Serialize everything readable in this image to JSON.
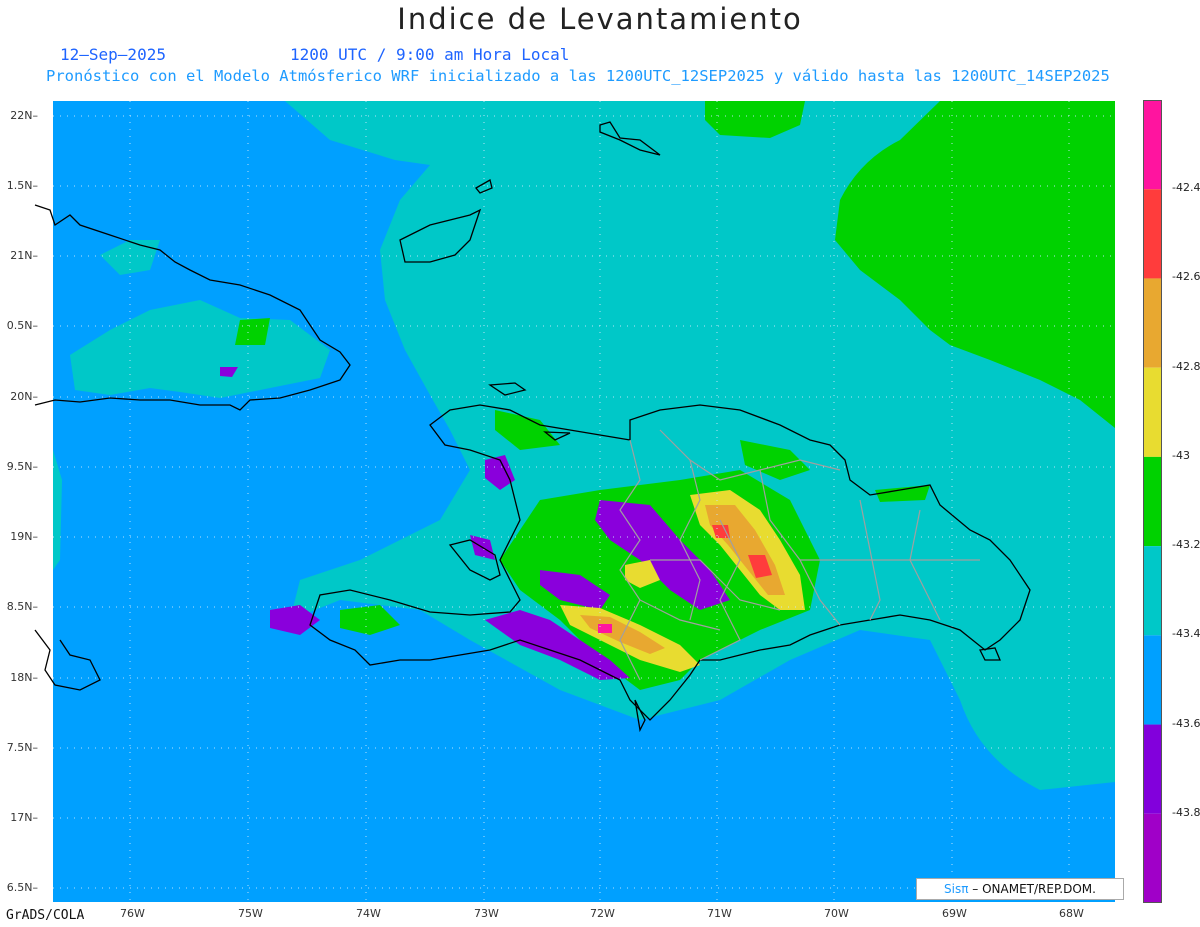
{
  "title": "Indice de Levantamiento",
  "date": "12–Sep–2025",
  "time_label": "1200 UTC / 9:00 am Hora Local",
  "model_line": "Pronóstico con el Modelo Atmósferico WRF inicializado a las 1200UTC_12SEP2025 y válido hasta las  1200UTC_14SEP2025",
  "lat_labels": [
    "22N",
    "1.5N",
    "21N",
    "0.5N",
    "20N",
    "9.5N",
    "19N",
    "8.5N",
    "18N",
    "7.5N",
    "17N",
    "6.5N"
  ],
  "lon_labels": [
    "76W",
    "75W",
    "74W",
    "73W",
    "72W",
    "71W",
    "70W",
    "69W",
    "68W"
  ],
  "colorbar": {
    "labels": [
      "-42.4",
      "-42.6",
      "-42.8",
      "-43",
      "-43.2",
      "-43.4",
      "-43.6",
      "-43.8"
    ],
    "colors": [
      "#ff149f",
      "#ff3c3c",
      "#e8a830",
      "#e8dc30",
      "#00d200",
      "#00c8c8",
      "#00a0ff",
      "#8200dc",
      "#a000c8"
    ]
  },
  "field_colors": {
    "ocean": "#00a0ff",
    "cyan": "#00c8c8",
    "green": "#00d200",
    "purple": "#8a00dc",
    "yellow": "#e8dc30",
    "orange": "#e8a830",
    "red": "#ff3c3c",
    "magenta": "#ff149f"
  },
  "footer_software": "GrADS/COLA",
  "credit_logo": "Sisπ",
  "credit_text": " – ONAMET/REP.DOM."
}
